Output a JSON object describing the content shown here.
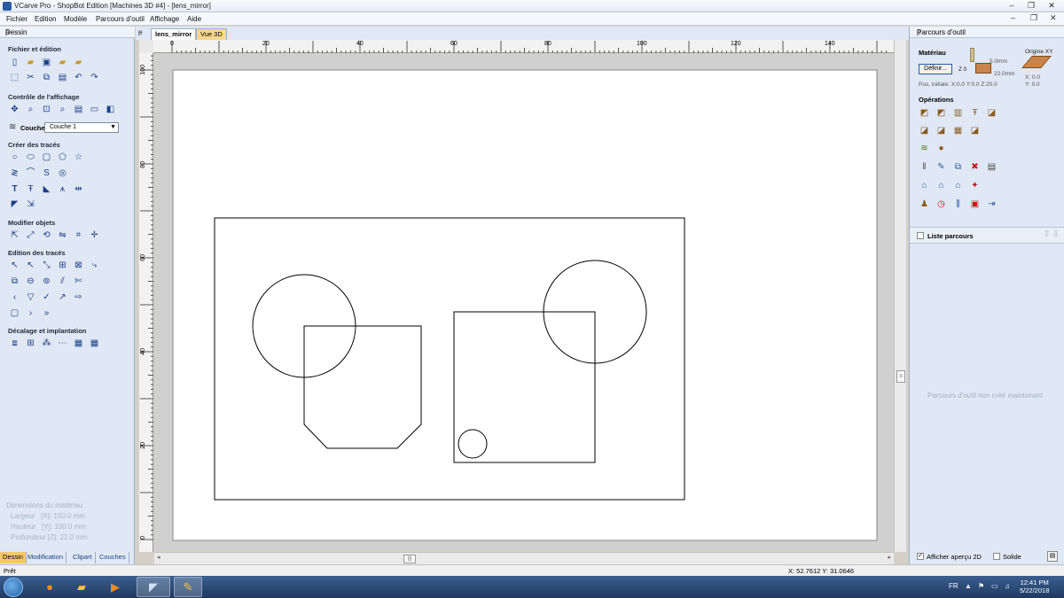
{
  "window": {
    "title": "VCarve Pro - ShopBot Edition [Machines 3D #4] - [lens_mirror]",
    "controls": [
      "–",
      "❐",
      "✕"
    ]
  },
  "menu": {
    "items": [
      "Fichier",
      "Edition",
      "Modèle",
      "Parcours d'outil",
      "Affichage",
      "Aide"
    ],
    "doc_controls": [
      "–",
      "❐",
      "✕"
    ]
  },
  "left_panel": {
    "header": "Dessin",
    "pin": "ᵽ",
    "sections": {
      "file": "Fichier et édition",
      "view": "Contrôle de l'affichage",
      "create": "Créer des tracés",
      "modify": "Modifier objets",
      "edit": "Edition des tracés",
      "offset": "Décalage et implantation"
    },
    "layer_label": "Couche",
    "layer_value": "Couche 1",
    "dims": {
      "title": "Dimensions du matériau",
      "width": "Largeur   [X]: 150.0 mm",
      "height": "Hauteur   [Y]: 100.0 mm",
      "depth": "Profondeur [Z]: 22.0 mm"
    },
    "tabs": [
      "Dessin",
      "Modification",
      "Clipart",
      "Couches"
    ]
  },
  "doc_tabs": {
    "pin": "ᵽ",
    "tabs": [
      "lens_mirror",
      "Vue 3D"
    ]
  },
  "rulers": {
    "top_labels": [
      "0",
      "20",
      "40",
      "60",
      "80",
      "100",
      "120",
      "140"
    ],
    "left_labels": [
      "100",
      "80",
      "60",
      "40",
      "20",
      "0"
    ]
  },
  "right_panel": {
    "header": "Parcours d'outil",
    "pin": "ᵽ",
    "material_title": "Matériau",
    "define_button": "Définir...",
    "z_label": "Z 0",
    "dim_top": "5.0mm",
    "dim_total": "22.0mm",
    "origin_title": "Origine XY",
    "origin_x": "X: 0.0",
    "origin_y": "Y: 0.0",
    "initial_pos": "Pos. initiale: X:0.0 Y:0.0 Z:20.0",
    "operations_title": "Opérations",
    "list_label": "Liste parcours",
    "list_arrows": "⇧⇩",
    "empty_note": "Parcours d'outil non créé maintenant",
    "preview_2d": "Afficher aperçu 2D",
    "preview_2d_checked": "✓",
    "solid": "Solide",
    "print_icon": "▤"
  },
  "statusbar": {
    "status": "Prêt",
    "coords": "X: 52.7612 Y: 31.0646"
  },
  "taskbar": {
    "tray_lang": "FR",
    "tray_icons": [
      "▲",
      "⚑",
      "▭",
      "♫"
    ],
    "time": "12:41 PM",
    "date": "5/22/2018"
  },
  "colors": {
    "panel_bg": "#dfe8f4",
    "active_tab": "#f5c96a",
    "doc_tab_active": "#ffffff",
    "vue3d_tab": "#f7d78a"
  }
}
